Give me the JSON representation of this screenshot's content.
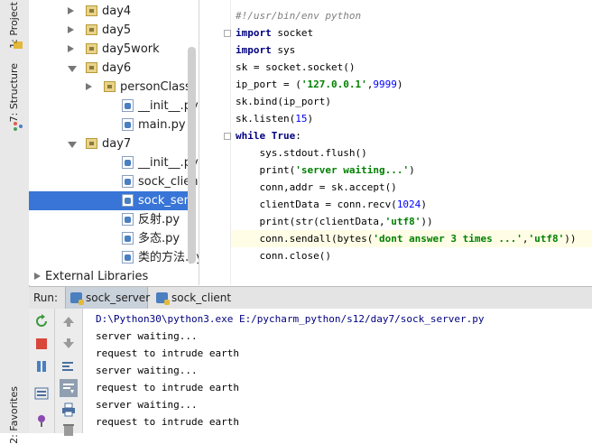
{
  "side_tabs": {
    "project": "1: Project",
    "structure": "7: Structure",
    "favorites": "2: Favorites"
  },
  "tree": {
    "items": [
      {
        "label": "day4",
        "type": "folder",
        "expanded": false,
        "level": 1
      },
      {
        "label": "day5",
        "type": "folder",
        "expanded": false,
        "level": 1
      },
      {
        "label": "day5work",
        "type": "folder",
        "expanded": false,
        "level": 1
      },
      {
        "label": "day6",
        "type": "folder",
        "expanded": true,
        "level": 1
      },
      {
        "label": "personClass",
        "type": "folder",
        "expanded": false,
        "level": 2
      },
      {
        "label": "__init__.py",
        "type": "py",
        "level": 2
      },
      {
        "label": "main.py",
        "type": "py",
        "level": 2
      },
      {
        "label": "day7",
        "type": "folder",
        "expanded": true,
        "level": 1
      },
      {
        "label": "__init__.py",
        "type": "py",
        "level": 2
      },
      {
        "label": "sock_client.py",
        "type": "py",
        "level": 2
      },
      {
        "label": "sock_server.py",
        "type": "py",
        "level": 2,
        "selected": true
      },
      {
        "label": "反射.py",
        "type": "py",
        "level": 2
      },
      {
        "label": "多态.py",
        "type": "py",
        "level": 2
      },
      {
        "label": "类的方法.py",
        "type": "py",
        "level": 2
      },
      {
        "label": "External Libraries",
        "type": "lib",
        "level": 0
      }
    ]
  },
  "editor": {
    "lines": [
      "#!/usr/bin/env python",
      "import socket",
      "import sys",
      "sk = socket.socket()",
      "ip_port = ('127.0.0.1',9999)",
      "sk.bind(ip_port)",
      "sk.listen(15)",
      "while True:",
      "    sys.stdout.flush()",
      "    print('server waiting...')",
      "    conn,addr = sk.accept()",
      "    clientData = conn.recv(1024)",
      "    print(str(clientData,'utf8'))",
      "    conn.sendall(bytes('dont answer 3 times ...','utf8'))",
      "    conn.close()"
    ],
    "highlighted_line": 13
  },
  "run": {
    "label": "Run:",
    "tabs": [
      {
        "label": "sock_server",
        "active": true
      },
      {
        "label": "sock_client",
        "active": false
      }
    ],
    "console": [
      "D:\\Python30\\python3.exe E:/pycharm_python/s12/day7/sock_server.py",
      "server waiting...",
      "request to intrude earth",
      "server waiting...",
      "request to intrude earth",
      "server waiting...",
      "request to intrude earth"
    ]
  },
  "colors": {
    "selection": "#3875d7",
    "keyword": "#000080",
    "string": "#008000",
    "comment": "#808080",
    "current_line": "#fffde6"
  }
}
